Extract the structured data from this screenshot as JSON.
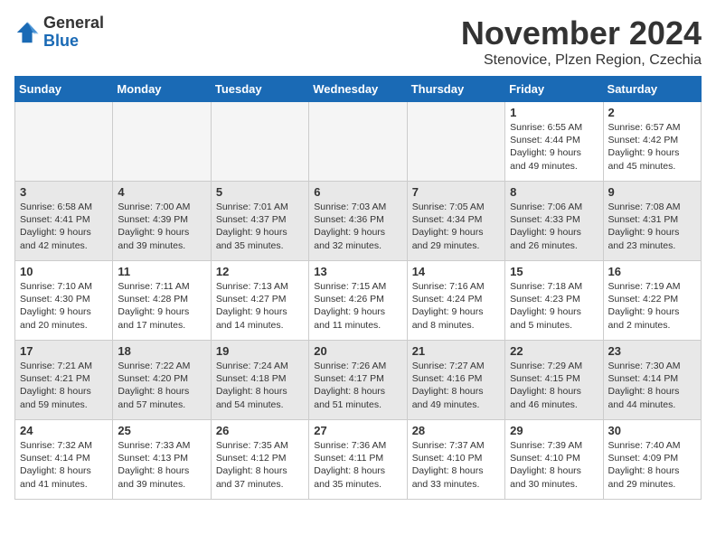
{
  "logo": {
    "general": "General",
    "blue": "Blue"
  },
  "title": "November 2024",
  "subtitle": "Stenovice, Plzen Region, Czechia",
  "days_of_week": [
    "Sunday",
    "Monday",
    "Tuesday",
    "Wednesday",
    "Thursday",
    "Friday",
    "Saturday"
  ],
  "weeks": [
    [
      {
        "day": "",
        "info": ""
      },
      {
        "day": "",
        "info": ""
      },
      {
        "day": "",
        "info": ""
      },
      {
        "day": "",
        "info": ""
      },
      {
        "day": "",
        "info": ""
      },
      {
        "day": "1",
        "info": "Sunrise: 6:55 AM\nSunset: 4:44 PM\nDaylight: 9 hours and 49 minutes."
      },
      {
        "day": "2",
        "info": "Sunrise: 6:57 AM\nSunset: 4:42 PM\nDaylight: 9 hours and 45 minutes."
      }
    ],
    [
      {
        "day": "3",
        "info": "Sunrise: 6:58 AM\nSunset: 4:41 PM\nDaylight: 9 hours and 42 minutes."
      },
      {
        "day": "4",
        "info": "Sunrise: 7:00 AM\nSunset: 4:39 PM\nDaylight: 9 hours and 39 minutes."
      },
      {
        "day": "5",
        "info": "Sunrise: 7:01 AM\nSunset: 4:37 PM\nDaylight: 9 hours and 35 minutes."
      },
      {
        "day": "6",
        "info": "Sunrise: 7:03 AM\nSunset: 4:36 PM\nDaylight: 9 hours and 32 minutes."
      },
      {
        "day": "7",
        "info": "Sunrise: 7:05 AM\nSunset: 4:34 PM\nDaylight: 9 hours and 29 minutes."
      },
      {
        "day": "8",
        "info": "Sunrise: 7:06 AM\nSunset: 4:33 PM\nDaylight: 9 hours and 26 minutes."
      },
      {
        "day": "9",
        "info": "Sunrise: 7:08 AM\nSunset: 4:31 PM\nDaylight: 9 hours and 23 minutes."
      }
    ],
    [
      {
        "day": "10",
        "info": "Sunrise: 7:10 AM\nSunset: 4:30 PM\nDaylight: 9 hours and 20 minutes."
      },
      {
        "day": "11",
        "info": "Sunrise: 7:11 AM\nSunset: 4:28 PM\nDaylight: 9 hours and 17 minutes."
      },
      {
        "day": "12",
        "info": "Sunrise: 7:13 AM\nSunset: 4:27 PM\nDaylight: 9 hours and 14 minutes."
      },
      {
        "day": "13",
        "info": "Sunrise: 7:15 AM\nSunset: 4:26 PM\nDaylight: 9 hours and 11 minutes."
      },
      {
        "day": "14",
        "info": "Sunrise: 7:16 AM\nSunset: 4:24 PM\nDaylight: 9 hours and 8 minutes."
      },
      {
        "day": "15",
        "info": "Sunrise: 7:18 AM\nSunset: 4:23 PM\nDaylight: 9 hours and 5 minutes."
      },
      {
        "day": "16",
        "info": "Sunrise: 7:19 AM\nSunset: 4:22 PM\nDaylight: 9 hours and 2 minutes."
      }
    ],
    [
      {
        "day": "17",
        "info": "Sunrise: 7:21 AM\nSunset: 4:21 PM\nDaylight: 8 hours and 59 minutes."
      },
      {
        "day": "18",
        "info": "Sunrise: 7:22 AM\nSunset: 4:20 PM\nDaylight: 8 hours and 57 minutes."
      },
      {
        "day": "19",
        "info": "Sunrise: 7:24 AM\nSunset: 4:18 PM\nDaylight: 8 hours and 54 minutes."
      },
      {
        "day": "20",
        "info": "Sunrise: 7:26 AM\nSunset: 4:17 PM\nDaylight: 8 hours and 51 minutes."
      },
      {
        "day": "21",
        "info": "Sunrise: 7:27 AM\nSunset: 4:16 PM\nDaylight: 8 hours and 49 minutes."
      },
      {
        "day": "22",
        "info": "Sunrise: 7:29 AM\nSunset: 4:15 PM\nDaylight: 8 hours and 46 minutes."
      },
      {
        "day": "23",
        "info": "Sunrise: 7:30 AM\nSunset: 4:14 PM\nDaylight: 8 hours and 44 minutes."
      }
    ],
    [
      {
        "day": "24",
        "info": "Sunrise: 7:32 AM\nSunset: 4:14 PM\nDaylight: 8 hours and 41 minutes."
      },
      {
        "day": "25",
        "info": "Sunrise: 7:33 AM\nSunset: 4:13 PM\nDaylight: 8 hours and 39 minutes."
      },
      {
        "day": "26",
        "info": "Sunrise: 7:35 AM\nSunset: 4:12 PM\nDaylight: 8 hours and 37 minutes."
      },
      {
        "day": "27",
        "info": "Sunrise: 7:36 AM\nSunset: 4:11 PM\nDaylight: 8 hours and 35 minutes."
      },
      {
        "day": "28",
        "info": "Sunrise: 7:37 AM\nSunset: 4:10 PM\nDaylight: 8 hours and 33 minutes."
      },
      {
        "day": "29",
        "info": "Sunrise: 7:39 AM\nSunset: 4:10 PM\nDaylight: 8 hours and 30 minutes."
      },
      {
        "day": "30",
        "info": "Sunrise: 7:40 AM\nSunset: 4:09 PM\nDaylight: 8 hours and 29 minutes."
      }
    ]
  ]
}
